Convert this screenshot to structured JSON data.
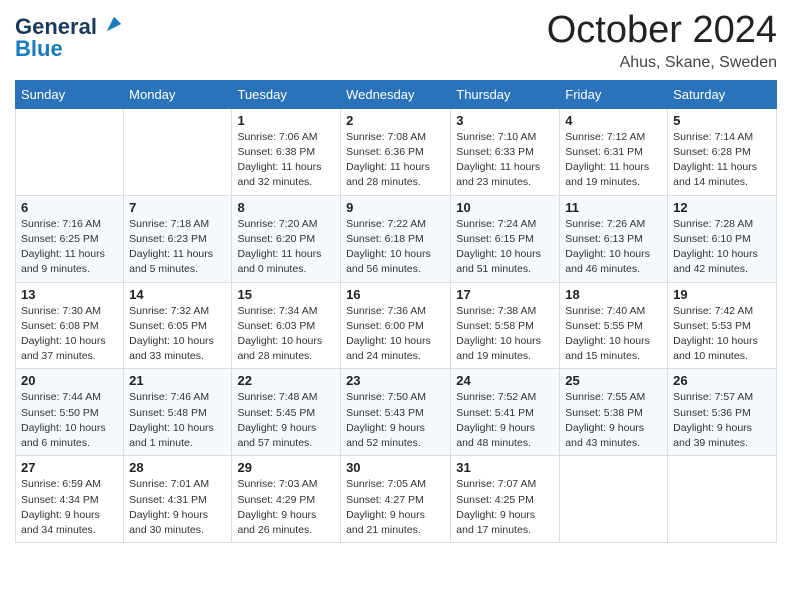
{
  "header": {
    "logo_line1": "General",
    "logo_line2": "Blue",
    "month": "October 2024",
    "location": "Ahus, Skane, Sweden"
  },
  "days_of_week": [
    "Sunday",
    "Monday",
    "Tuesday",
    "Wednesday",
    "Thursday",
    "Friday",
    "Saturday"
  ],
  "weeks": [
    [
      {
        "num": "",
        "info": ""
      },
      {
        "num": "",
        "info": ""
      },
      {
        "num": "1",
        "info": "Sunrise: 7:06 AM\nSunset: 6:38 PM\nDaylight: 11 hours\nand 32 minutes."
      },
      {
        "num": "2",
        "info": "Sunrise: 7:08 AM\nSunset: 6:36 PM\nDaylight: 11 hours\nand 28 minutes."
      },
      {
        "num": "3",
        "info": "Sunrise: 7:10 AM\nSunset: 6:33 PM\nDaylight: 11 hours\nand 23 minutes."
      },
      {
        "num": "4",
        "info": "Sunrise: 7:12 AM\nSunset: 6:31 PM\nDaylight: 11 hours\nand 19 minutes."
      },
      {
        "num": "5",
        "info": "Sunrise: 7:14 AM\nSunset: 6:28 PM\nDaylight: 11 hours\nand 14 minutes."
      }
    ],
    [
      {
        "num": "6",
        "info": "Sunrise: 7:16 AM\nSunset: 6:25 PM\nDaylight: 11 hours\nand 9 minutes."
      },
      {
        "num": "7",
        "info": "Sunrise: 7:18 AM\nSunset: 6:23 PM\nDaylight: 11 hours\nand 5 minutes."
      },
      {
        "num": "8",
        "info": "Sunrise: 7:20 AM\nSunset: 6:20 PM\nDaylight: 11 hours\nand 0 minutes."
      },
      {
        "num": "9",
        "info": "Sunrise: 7:22 AM\nSunset: 6:18 PM\nDaylight: 10 hours\nand 56 minutes."
      },
      {
        "num": "10",
        "info": "Sunrise: 7:24 AM\nSunset: 6:15 PM\nDaylight: 10 hours\nand 51 minutes."
      },
      {
        "num": "11",
        "info": "Sunrise: 7:26 AM\nSunset: 6:13 PM\nDaylight: 10 hours\nand 46 minutes."
      },
      {
        "num": "12",
        "info": "Sunrise: 7:28 AM\nSunset: 6:10 PM\nDaylight: 10 hours\nand 42 minutes."
      }
    ],
    [
      {
        "num": "13",
        "info": "Sunrise: 7:30 AM\nSunset: 6:08 PM\nDaylight: 10 hours\nand 37 minutes."
      },
      {
        "num": "14",
        "info": "Sunrise: 7:32 AM\nSunset: 6:05 PM\nDaylight: 10 hours\nand 33 minutes."
      },
      {
        "num": "15",
        "info": "Sunrise: 7:34 AM\nSunset: 6:03 PM\nDaylight: 10 hours\nand 28 minutes."
      },
      {
        "num": "16",
        "info": "Sunrise: 7:36 AM\nSunset: 6:00 PM\nDaylight: 10 hours\nand 24 minutes."
      },
      {
        "num": "17",
        "info": "Sunrise: 7:38 AM\nSunset: 5:58 PM\nDaylight: 10 hours\nand 19 minutes."
      },
      {
        "num": "18",
        "info": "Sunrise: 7:40 AM\nSunset: 5:55 PM\nDaylight: 10 hours\nand 15 minutes."
      },
      {
        "num": "19",
        "info": "Sunrise: 7:42 AM\nSunset: 5:53 PM\nDaylight: 10 hours\nand 10 minutes."
      }
    ],
    [
      {
        "num": "20",
        "info": "Sunrise: 7:44 AM\nSunset: 5:50 PM\nDaylight: 10 hours\nand 6 minutes."
      },
      {
        "num": "21",
        "info": "Sunrise: 7:46 AM\nSunset: 5:48 PM\nDaylight: 10 hours\nand 1 minute."
      },
      {
        "num": "22",
        "info": "Sunrise: 7:48 AM\nSunset: 5:45 PM\nDaylight: 9 hours\nand 57 minutes."
      },
      {
        "num": "23",
        "info": "Sunrise: 7:50 AM\nSunset: 5:43 PM\nDaylight: 9 hours\nand 52 minutes."
      },
      {
        "num": "24",
        "info": "Sunrise: 7:52 AM\nSunset: 5:41 PM\nDaylight: 9 hours\nand 48 minutes."
      },
      {
        "num": "25",
        "info": "Sunrise: 7:55 AM\nSunset: 5:38 PM\nDaylight: 9 hours\nand 43 minutes."
      },
      {
        "num": "26",
        "info": "Sunrise: 7:57 AM\nSunset: 5:36 PM\nDaylight: 9 hours\nand 39 minutes."
      }
    ],
    [
      {
        "num": "27",
        "info": "Sunrise: 6:59 AM\nSunset: 4:34 PM\nDaylight: 9 hours\nand 34 minutes."
      },
      {
        "num": "28",
        "info": "Sunrise: 7:01 AM\nSunset: 4:31 PM\nDaylight: 9 hours\nand 30 minutes."
      },
      {
        "num": "29",
        "info": "Sunrise: 7:03 AM\nSunset: 4:29 PM\nDaylight: 9 hours\nand 26 minutes."
      },
      {
        "num": "30",
        "info": "Sunrise: 7:05 AM\nSunset: 4:27 PM\nDaylight: 9 hours\nand 21 minutes."
      },
      {
        "num": "31",
        "info": "Sunrise: 7:07 AM\nSunset: 4:25 PM\nDaylight: 9 hours\nand 17 minutes."
      },
      {
        "num": "",
        "info": ""
      },
      {
        "num": "",
        "info": ""
      }
    ]
  ]
}
